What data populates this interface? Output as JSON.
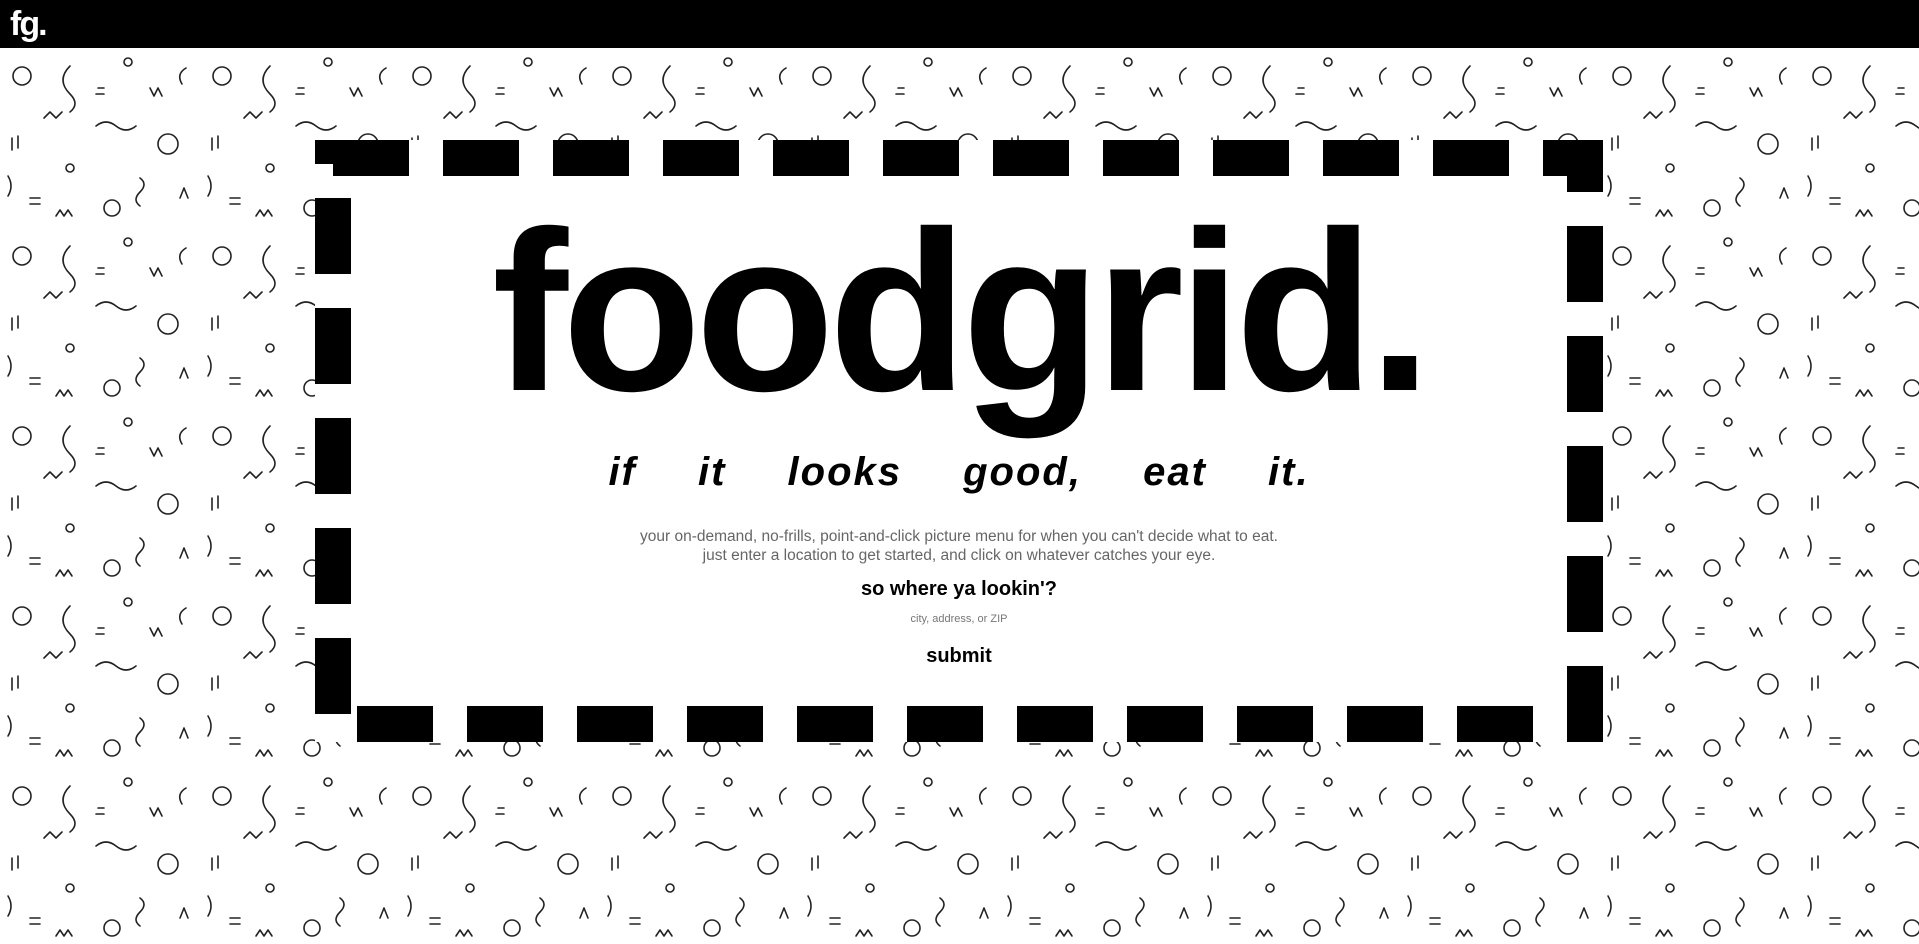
{
  "header": {
    "logo_text": "fg.",
    "background": "#000000"
  },
  "hero": {
    "brand": "foodgrid.",
    "tagline": "if it looks good, eat it.",
    "description_line1": "your on-demand, no-frills, point-and-click picture menu for when you can't decide what to eat.",
    "description_line2": "just enter a location to get started, and click on whatever catches your eye."
  },
  "search": {
    "prompt": "so where ya lookin'?",
    "placeholder": "city, address, or ZIP",
    "value": "",
    "submit_label": "submit"
  },
  "colors": {
    "frame": "#000000",
    "description": "#666666",
    "pattern_stroke": "#222222"
  },
  "icons": {
    "background_pattern": "doodle-pattern",
    "frame": "dashed-border"
  }
}
